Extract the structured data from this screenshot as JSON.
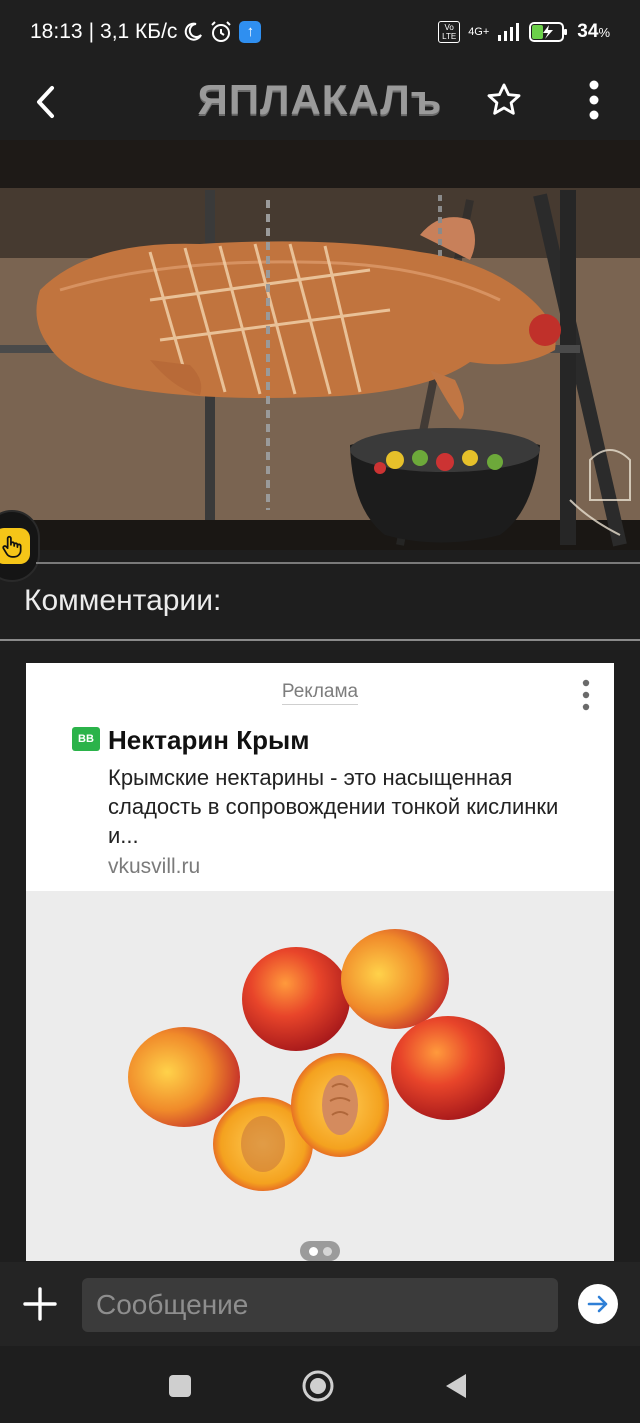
{
  "status_bar": {
    "time": "18:13",
    "speed": "3,1 КБ/с",
    "volte": "Vo LTE",
    "network": "4G+",
    "battery": "34",
    "battery_unit": "%",
    "icons": [
      "moon-icon",
      "alarm-icon",
      "upload-icon",
      "signal-icon",
      "battery-charging-icon"
    ]
  },
  "app_bar": {
    "logo_text": "ЯПЛАКАЛъ",
    "icons": [
      "back-arrow-icon",
      "star-icon",
      "more-vertical-icon"
    ]
  },
  "post": {
    "image_alt": "roast-pig-on-spit"
  },
  "comments": {
    "title": "Комментарии:"
  },
  "ad": {
    "label": "Реклама",
    "logo_text": "BB",
    "title": "Нектарин Крым",
    "description": "Крымские нектарины - это насыщенная сладость в сопровождении тонкой кислинки и...",
    "domain": "vkusvill.ru",
    "carousel": {
      "pages": 2,
      "current": 1
    }
  },
  "composer": {
    "placeholder": "Сообщение"
  },
  "colors": {
    "background": "#1e1e1e",
    "accent_blue": "#2f8ff0",
    "ad_logo_green": "#2bb34a"
  }
}
